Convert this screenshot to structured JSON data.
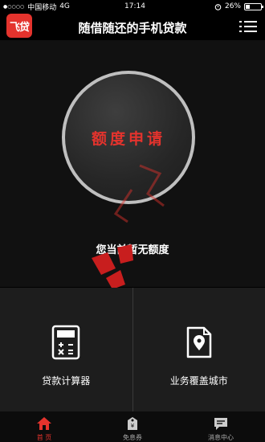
{
  "status_bar": {
    "signal_dots": "●○○○○",
    "carrier": "中国移动",
    "network": "4G",
    "time": "17:14",
    "battery_percent": "26%",
    "battery_level": 0.26
  },
  "header": {
    "logo_text": "飞贷",
    "title": "随借随还的手机贷款",
    "menu_icon": "list-menu-icon"
  },
  "hero": {
    "apply_button_label": "额度申请",
    "quota_status": "您当前暂无额度"
  },
  "tiles": [
    {
      "label": "贷款计算器",
      "icon": "calculator-icon"
    },
    {
      "label": "业务覆盖城市",
      "icon": "location-document-icon"
    }
  ],
  "tabbar": {
    "items": [
      {
        "label": "首 页",
        "icon": "home-icon",
        "active": true
      },
      {
        "label": "免息券",
        "icon": "coupon-tag-icon",
        "active": false
      },
      {
        "label": "消息中心",
        "icon": "message-icon",
        "active": false
      }
    ]
  },
  "colors": {
    "accent": "#e4332d",
    "background": "#000000",
    "panel": "#1d1d1d"
  }
}
